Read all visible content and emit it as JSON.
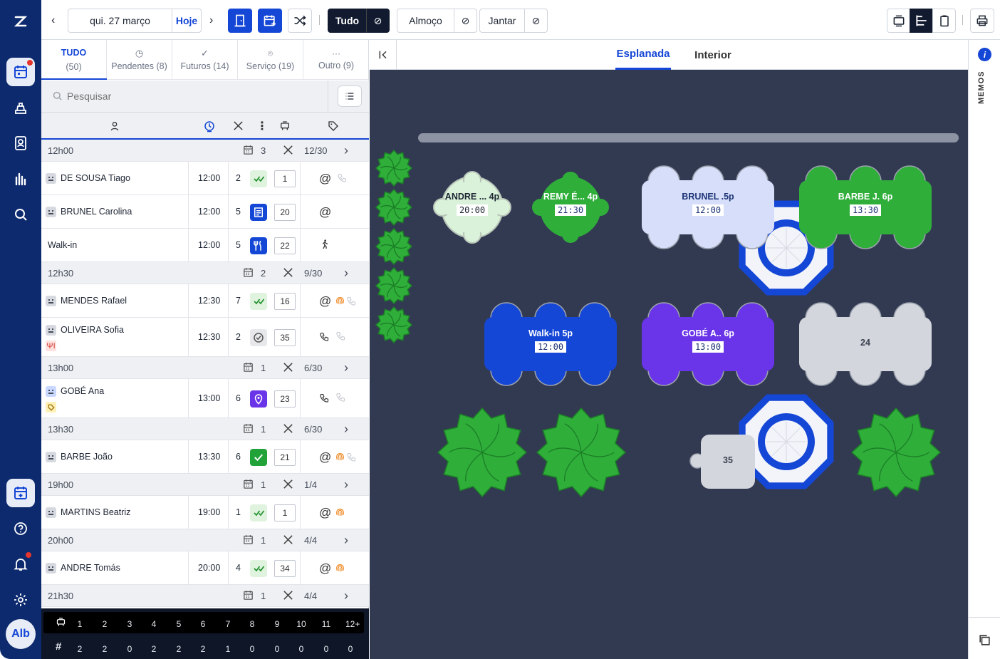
{
  "topbar": {
    "date": "qui. 27 março",
    "today": "Hoje",
    "filters": [
      "Tudo",
      "Almoço",
      "Jantar"
    ]
  },
  "leftnav": {
    "avatar": "Alb"
  },
  "tabs": [
    {
      "label": "TUDO",
      "count": "(50)",
      "icon": "all"
    },
    {
      "label": "Pendentes (8)",
      "icon": "clock-icon"
    },
    {
      "label": "Futuros (14)",
      "icon": "check-icon"
    },
    {
      "label": "Serviço (19)",
      "icon": "pin-icon"
    },
    {
      "label": "Outro (9)",
      "icon": "dots-icon"
    }
  ],
  "search": {
    "placeholder": "Pesquisar"
  },
  "groups": [
    {
      "time": "12h00",
      "bookings": "3",
      "covers": "12/30",
      "rows": [
        {
          "name": "DE SOUSA  Tiago",
          "time": "12:00",
          "size": "2",
          "status": "arrived",
          "table": "1",
          "contact": "at-phone"
        },
        {
          "name": "BRUNEL  Carolina",
          "time": "12:00",
          "size": "5",
          "status": "booked",
          "table": "20",
          "contact": "at"
        },
        {
          "name": "Walk-in",
          "time": "12:00",
          "size": "5",
          "status": "seated",
          "table": "22",
          "contact": "walk"
        }
      ]
    },
    {
      "time": "12h30",
      "bookings": "2",
      "covers": "9/30",
      "rows": [
        {
          "name": "MENDES  Rafael",
          "time": "12:30",
          "size": "7",
          "status": "arrived",
          "table": "16",
          "contact": "at-finger-phone"
        },
        {
          "name": "OLIVEIRA  Sofia",
          "time": "12:30",
          "size": "2",
          "status": "confirmed",
          "table": "35",
          "contact": "phone-phone",
          "tag": "fork"
        }
      ]
    },
    {
      "time": "13h00",
      "bookings": "1",
      "covers": "6/30",
      "rows": [
        {
          "name": "GOBÉ  Ana",
          "time": "13:00",
          "size": "6",
          "status": "location",
          "table": "23",
          "contact": "phone-phone",
          "tag": "label",
          "vip": true
        }
      ]
    },
    {
      "time": "13h30",
      "bookings": "1",
      "covers": "6/30",
      "rows": [
        {
          "name": "BARBE  João",
          "time": "13:30",
          "size": "6",
          "status": "done",
          "table": "21",
          "contact": "at-finger-phone"
        }
      ]
    },
    {
      "time": "19h00",
      "bookings": "1",
      "covers": "1/4",
      "rows": [
        {
          "name": "MARTINS  Beatriz",
          "time": "19:00",
          "size": "1",
          "status": "arrived",
          "table": "1",
          "contact": "at-finger"
        }
      ]
    },
    {
      "time": "20h00",
      "bookings": "1",
      "covers": "4/4",
      "rows": [
        {
          "name": "ANDRE  Tomás",
          "time": "20:00",
          "size": "4",
          "status": "arrived",
          "table": "34",
          "contact": "at-finger"
        }
      ]
    },
    {
      "time": "21h30",
      "bookings": "1",
      "covers": "4/4",
      "rows": []
    }
  ],
  "footer": {
    "sizes": [
      "1",
      "2",
      "3",
      "4",
      "5",
      "6",
      "7",
      "8",
      "9",
      "10",
      "11",
      "12+"
    ],
    "counts": [
      "2",
      "2",
      "0",
      "2",
      "2",
      "2",
      "1",
      "0",
      "0",
      "0",
      "0",
      "0"
    ]
  },
  "floor": {
    "tabs": [
      "Esplanada",
      "Interior"
    ],
    "tables": [
      {
        "label": "ANDRE ... 4p",
        "time": "20:00",
        "color": "#d9f2d9",
        "text": "#1d2533"
      },
      {
        "label": "REMY É... 4p",
        "time": "21:30",
        "color": "#2fae3a",
        "text": "#ffffff"
      },
      {
        "label": "BRUNEL .5p",
        "time": "12:00",
        "color": "#d6defa",
        "text": "#1d3476"
      },
      {
        "label": "BARBE J. 6p",
        "time": "13:30",
        "color": "#2fae3a",
        "text": "#ffffff"
      },
      {
        "label": "Walk-in 5p",
        "time": "12:00",
        "color": "#1547d6",
        "text": "#ffffff"
      },
      {
        "label": "GOBÉ A.. 6p",
        "time": "13:00",
        "color": "#6a35e8",
        "text": "#ffffff"
      },
      {
        "label": "24",
        "color": "#d3d6dc",
        "text": "#3a4150"
      },
      {
        "label": "35",
        "color": "#d3d6dc",
        "text": "#3a4150"
      }
    ]
  },
  "memos": {
    "label": "MEMOS"
  }
}
